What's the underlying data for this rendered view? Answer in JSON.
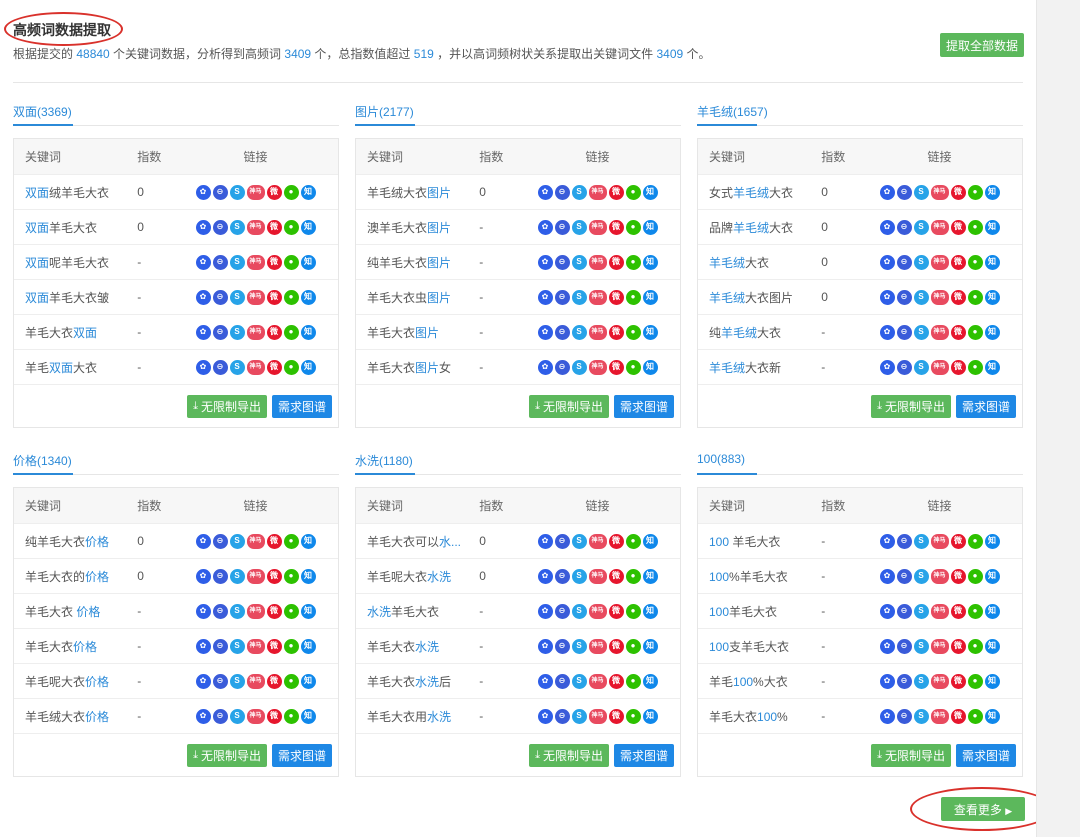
{
  "header": {
    "title": "高频词数据提取",
    "summary": {
      "p1": "根据提交的 ",
      "n1": "48840",
      "p2": " 个关键词数据，分析得到高频词 ",
      "n2": "3409",
      "p3": " 个，总指数值超过 ",
      "n3": "519",
      "p4": " ，并以高词频树状关系提取出关键词文件 ",
      "n4": "3409",
      "p5": " 个。"
    },
    "extract_all_label": "提取全部数据"
  },
  "table_headers": {
    "keyword": "关键词",
    "index": "指数",
    "links": "链接"
  },
  "icons": {
    "baidu": {
      "name": "baidu-paw-icon",
      "glyph": "✿",
      "color": "#2e5ee8"
    },
    "so360": {
      "name": "so360-icon",
      "glyph": "⊖",
      "color": "#3a5bd9"
    },
    "sogou": {
      "name": "sogou-icon",
      "glyph": "S",
      "color": "#27a3e8"
    },
    "shenma": {
      "name": "shenma-icon",
      "glyph": "神马",
      "color": "#e84a5f"
    },
    "weibo": {
      "name": "weibo-icon",
      "glyph": "微",
      "color": "#e6162d"
    },
    "wechat": {
      "name": "wechat-icon",
      "glyph": "●",
      "color": "#2dc100"
    },
    "zhihu": {
      "name": "zhihu-icon",
      "glyph": "知",
      "color": "#0f88eb"
    }
  },
  "footer_buttons": {
    "export_label": "无限制导出",
    "graph_label": "需求图谱"
  },
  "groups": [
    {
      "tab": "双面(3369)",
      "rows": [
        {
          "pre": "",
          "hl": "双面",
          "post": "绒羊毛大衣",
          "index": "0"
        },
        {
          "pre": "",
          "hl": "双面",
          "post": "羊毛大衣",
          "index": "0"
        },
        {
          "pre": "",
          "hl": "双面",
          "post": "呢羊毛大衣",
          "index": "-"
        },
        {
          "pre": "",
          "hl": "双面",
          "post": "羊毛大衣皱",
          "index": "-"
        },
        {
          "pre": "羊毛大衣",
          "hl": "双面",
          "post": "",
          "index": "-"
        },
        {
          "pre": "羊毛",
          "hl": "双面",
          "post": "大衣",
          "index": "-"
        }
      ]
    },
    {
      "tab": "图片(2177)",
      "rows": [
        {
          "pre": "羊毛绒大衣",
          "hl": "图片",
          "post": "",
          "index": "0"
        },
        {
          "pre": "澳羊毛大衣",
          "hl": "图片",
          "post": "",
          "index": "-"
        },
        {
          "pre": "纯羊毛大衣",
          "hl": "图片",
          "post": "",
          "index": "-"
        },
        {
          "pre": "羊毛大衣虫",
          "hl": "图片",
          "post": "",
          "index": "-"
        },
        {
          "pre": "羊毛大衣",
          "hl": "图片",
          "post": "",
          "index": "-"
        },
        {
          "pre": "羊毛大衣",
          "hl": "图片",
          "post": "女",
          "index": "-"
        }
      ]
    },
    {
      "tab": "羊毛绒(1657)",
      "rows": [
        {
          "pre": "女式",
          "hl": "羊毛绒",
          "post": "大衣",
          "index": "0"
        },
        {
          "pre": "品牌",
          "hl": "羊毛绒",
          "post": "大衣",
          "index": "0"
        },
        {
          "pre": "",
          "hl": "羊毛绒",
          "post": "大衣",
          "index": "0"
        },
        {
          "pre": "",
          "hl": "羊毛绒",
          "post": "大衣图片",
          "index": "0"
        },
        {
          "pre": "纯",
          "hl": "羊毛绒",
          "post": "大衣",
          "index": "-"
        },
        {
          "pre": "",
          "hl": "羊毛绒",
          "post": "大衣新",
          "index": "-"
        }
      ]
    },
    {
      "tab": "价格(1340)",
      "rows": [
        {
          "pre": "纯羊毛大衣",
          "hl": "价格",
          "post": "",
          "index": "0"
        },
        {
          "pre": "羊毛大衣的",
          "hl": "价格",
          "post": "",
          "index": "0"
        },
        {
          "pre": "羊毛大衣 ",
          "hl": "价格",
          "post": "",
          "index": "-"
        },
        {
          "pre": "羊毛大衣",
          "hl": "价格",
          "post": "",
          "index": "-"
        },
        {
          "pre": "羊毛呢大衣",
          "hl": "价格",
          "post": "",
          "index": "-"
        },
        {
          "pre": "羊毛绒大衣",
          "hl": "价格",
          "post": "",
          "index": "-"
        }
      ]
    },
    {
      "tab": "水洗(1180)",
      "rows": [
        {
          "pre": "羊毛大衣可以",
          "hl": "水...",
          "post": "",
          "index": "0"
        },
        {
          "pre": "羊毛呢大衣",
          "hl": "水洗",
          "post": "",
          "index": "0"
        },
        {
          "pre": "",
          "hl": "水洗",
          "post": "羊毛大衣",
          "index": "-"
        },
        {
          "pre": "羊毛大衣",
          "hl": "水洗",
          "post": "",
          "index": "-"
        },
        {
          "pre": "羊毛大衣",
          "hl": "水洗",
          "post": "后",
          "index": "-"
        },
        {
          "pre": "羊毛大衣用",
          "hl": "水洗",
          "post": "",
          "index": "-"
        }
      ]
    },
    {
      "tab": "100(883)",
      "rows": [
        {
          "pre": "",
          "hl": "100",
          "post": " 羊毛大衣",
          "index": "-"
        },
        {
          "pre": "",
          "hl": "100",
          "post": "%羊毛大衣",
          "index": "-"
        },
        {
          "pre": "",
          "hl": "100",
          "post": "羊毛大衣",
          "index": "-"
        },
        {
          "pre": "",
          "hl": "100",
          "post": "支羊毛大衣",
          "index": "-"
        },
        {
          "pre": "羊毛",
          "hl": "100",
          "post": "%大衣",
          "index": "-"
        },
        {
          "pre": "羊毛大衣",
          "hl": "100",
          "post": "%",
          "index": "-"
        }
      ]
    }
  ],
  "more_label": "查看更多",
  "more_arrow": "▶",
  "export_icon_glyph": "⤓"
}
